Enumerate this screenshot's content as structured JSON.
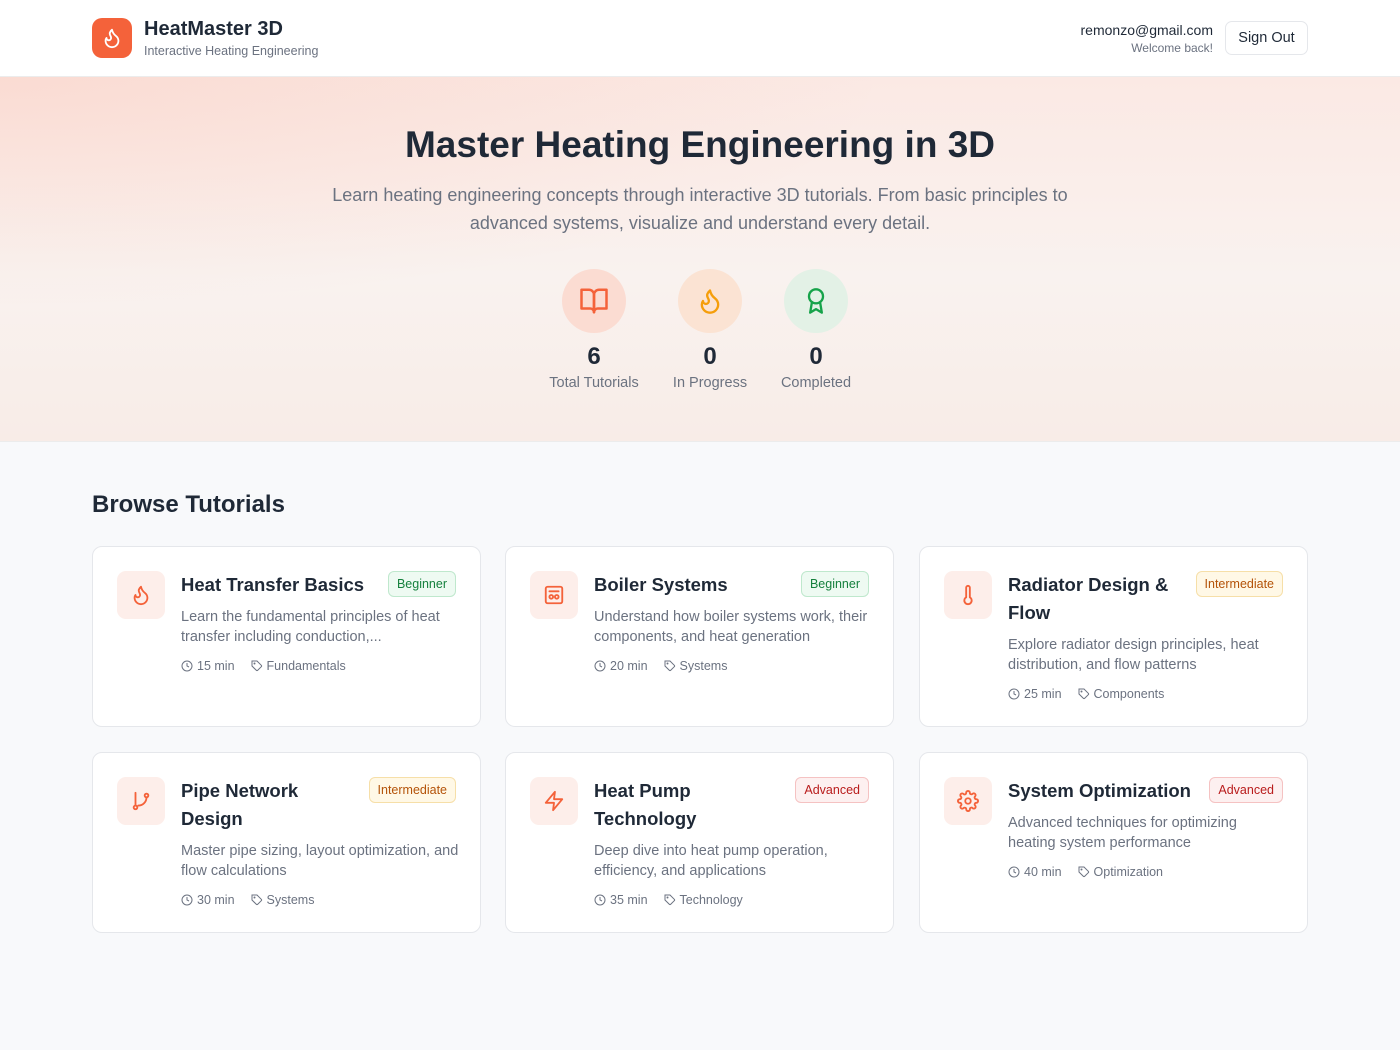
{
  "header": {
    "brand_title": "HeatMaster 3D",
    "brand_subtitle": "Interactive Heating Engineering",
    "user_email": "remonzo@gmail.com",
    "welcome": "Welcome back!",
    "signout_label": "Sign Out"
  },
  "hero": {
    "title": "Master Heating Engineering in 3D",
    "description": "Learn heating engineering concepts through interactive 3D tutorials. From basic principles to advanced systems, visualize and understand every detail.",
    "stats": [
      {
        "value": "6",
        "label": "Total Tutorials",
        "icon": "book-open-icon",
        "color": "#f4623a"
      },
      {
        "value": "0",
        "label": "In Progress",
        "icon": "flame-icon",
        "color": "#f59e0b"
      },
      {
        "value": "0",
        "label": "Completed",
        "icon": "award-icon",
        "color": "#16a34a"
      }
    ]
  },
  "browse": {
    "title": "Browse Tutorials",
    "tutorials": [
      {
        "title": "Heat Transfer Basics",
        "level": "Beginner",
        "description": "Learn the fundamental principles of heat transfer including conduction,...",
        "duration": "15 min",
        "category": "Fundamentals",
        "icon": "flame-icon"
      },
      {
        "title": "Boiler Systems",
        "level": "Beginner",
        "description": "Understand how boiler systems work, their components, and heat generation",
        "duration": "20 min",
        "category": "Systems",
        "icon": "boiler-icon"
      },
      {
        "title": "Radiator Design & Flow",
        "level": "Intermediate",
        "description": "Explore radiator design principles, heat distribution, and flow patterns",
        "duration": "25 min",
        "category": "Components",
        "icon": "thermometer-icon"
      },
      {
        "title": "Pipe Network Design",
        "level": "Intermediate",
        "description": "Master pipe sizing, layout optimization, and flow calculations",
        "duration": "30 min",
        "category": "Systems",
        "icon": "git-branch-icon"
      },
      {
        "title": "Heat Pump Technology",
        "level": "Advanced",
        "description": "Deep dive into heat pump operation, efficiency, and applications",
        "duration": "35 min",
        "category": "Technology",
        "icon": "zap-icon"
      },
      {
        "title": "System Optimization",
        "level": "Advanced",
        "description": "Advanced techniques for optimizing heating system performance",
        "duration": "40 min",
        "category": "Optimization",
        "icon": "settings-icon"
      }
    ]
  }
}
